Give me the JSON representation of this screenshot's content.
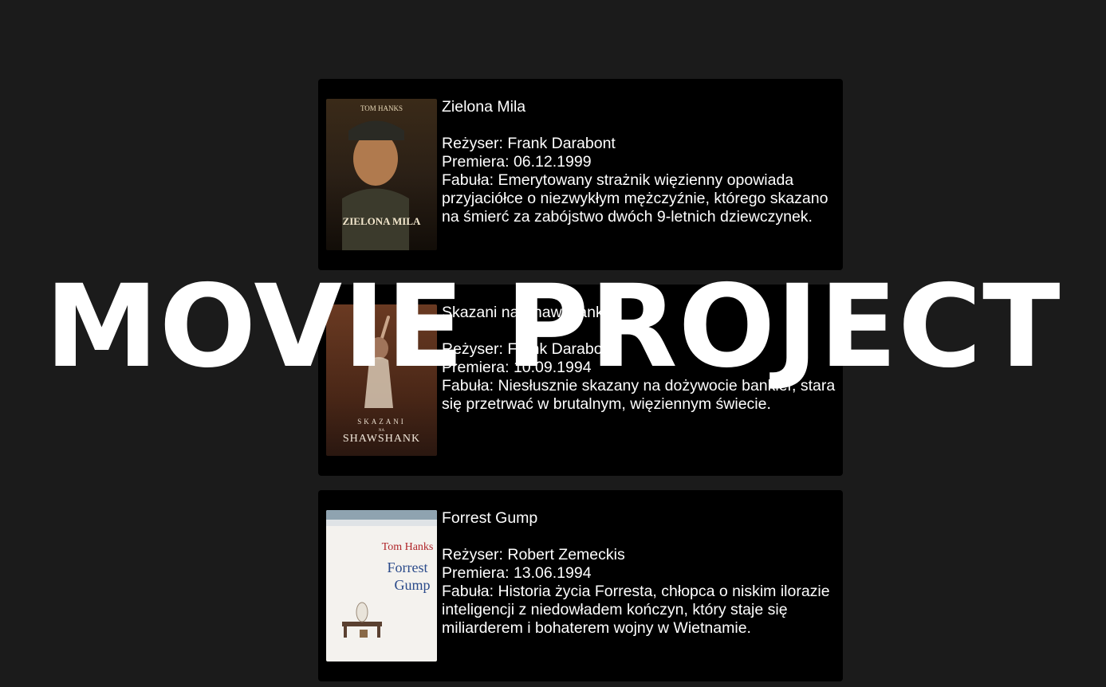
{
  "headline": "MOVIE PROJECT",
  "movies": [
    {
      "title": "Zielona Mila",
      "director_label": "Reżyser: ",
      "director": "Frank Darabont",
      "premiere_label": "Premiera: ",
      "premiere": "06.12.1999",
      "plot_label": "Fabuła: ",
      "plot": "Emerytowany strażnik więzienny opowiada przyjaciółce o niezwykłym mężczyźnie, którego skazano na śmierć za zabójstwo dwóch 9-letnich dziewczynek.",
      "poster_text": {
        "top": "TOM HANKS",
        "bottom": "ZIELONA MILA"
      }
    },
    {
      "title": "Skazani na Shawshank",
      "director_label": "Reżyser: ",
      "director": "Frank Darabont",
      "premiere_label": "Premiera: ",
      "premiere": "10.09.1994",
      "plot_label": "Fabuła: ",
      "plot": "Niesłusznie skazany na dożywocie bankier, stara się przetrwać w brutalnym, więziennym świecie.",
      "poster_text": {
        "top": "SKAZANI",
        "middle": "NA",
        "bottom": "SHAWSHANK"
      }
    },
    {
      "title": "Forrest Gump",
      "director_label": "Reżyser: ",
      "director": "Robert Zemeckis",
      "premiere_label": "Premiera: ",
      "premiere": "13.06.1994",
      "plot_label": "Fabuła: ",
      "plot": "Historia życia Forresta, chłopca o niskim ilorazie inteligencji z niedowładem kończyn, który staje się miliarderem i bohaterem wojny w Wietnamie.",
      "poster_text": {
        "top": "Tom Hanks",
        "middle": "Forrest",
        "bottom": "Gump"
      }
    }
  ]
}
